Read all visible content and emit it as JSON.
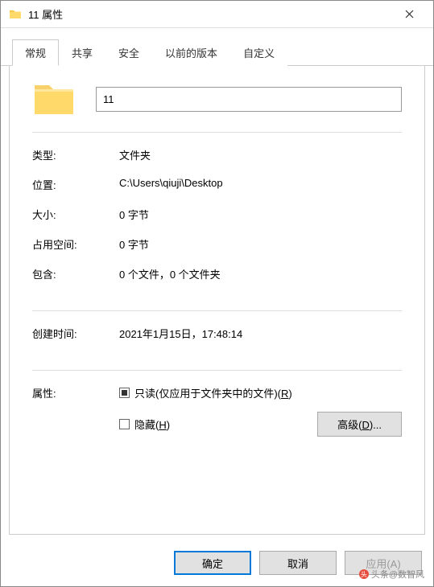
{
  "window": {
    "title": "11 属性"
  },
  "tabs": {
    "general": "常规",
    "sharing": "共享",
    "security": "安全",
    "previous": "以前的版本",
    "customize": "自定义"
  },
  "name_field": {
    "value": "11"
  },
  "info": {
    "type_label": "类型:",
    "type_value": "文件夹",
    "location_label": "位置:",
    "location_value": "C:\\Users\\qiuji\\Desktop",
    "size_label": "大小:",
    "size_value": "0 字节",
    "size_on_disk_label": "占用空间:",
    "size_on_disk_value": "0 字节",
    "contains_label": "包含:",
    "contains_value": "0 个文件，0 个文件夹",
    "created_label": "创建时间:",
    "created_value": "2021年1月15日，17:48:14"
  },
  "attributes": {
    "label": "属性:",
    "readonly_text": "只读(仅应用于文件夹中的文件)(",
    "readonly_key": "R",
    "readonly_suffix": ")",
    "hidden_text": "隐藏(",
    "hidden_key": "H",
    "hidden_suffix": ")",
    "advanced_text": "高级(",
    "advanced_key": "D",
    "advanced_suffix": ")..."
  },
  "footer": {
    "ok": "确定",
    "cancel": "取消",
    "apply": "应用(A)"
  },
  "watermark": {
    "text": "头条@数智风"
  }
}
